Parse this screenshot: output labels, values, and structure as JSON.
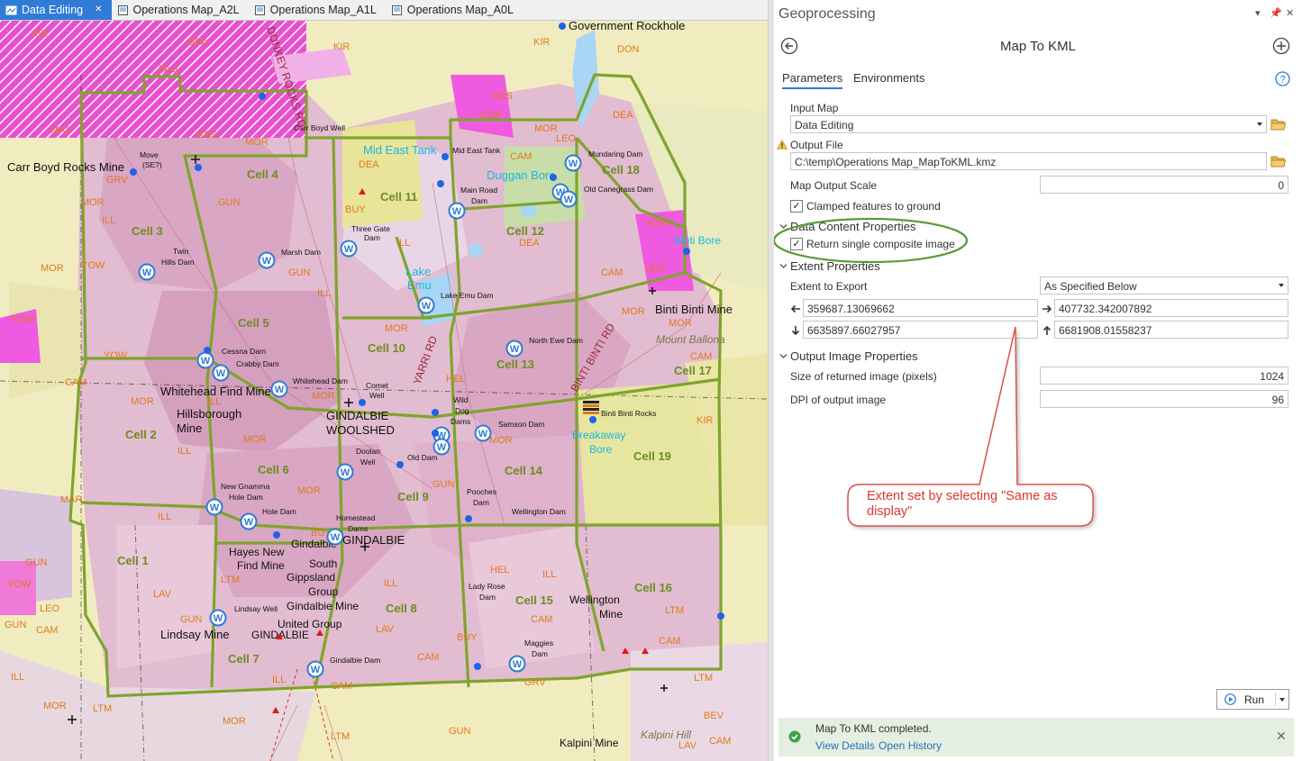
{
  "map_tabs": [
    {
      "label": "Data Editing",
      "active": true
    },
    {
      "label": "Operations Map_A2L",
      "active": false
    },
    {
      "label": "Operations Map_A1L",
      "active": false
    },
    {
      "label": "Operations Map_A0L",
      "active": false
    }
  ],
  "map": {
    "cells": [
      "Cell 1",
      "Cell 2",
      "Cell 3",
      "Cell 4",
      "Cell 5",
      "Cell 6",
      "Cell 7",
      "Cell 8",
      "Cell 9",
      "Cell 10",
      "Cell 11",
      "Cell 12",
      "Cell 13",
      "Cell 14",
      "Cell 15",
      "Cell 16",
      "Cell 17",
      "Cell 18",
      "Cell 19"
    ],
    "places": [
      "Government Rockhole",
      "Carr Boyd Rocks Mine",
      "Mid East Tank",
      "Duggan Bore",
      "Lake Emu",
      "Binti Bore",
      "Binti Binti Mine",
      "Mount Ballona",
      "Whitehead Find Mine",
      "Hillsborough Mine",
      "GINDALBIE WOOLSHED",
      "GINDALBIE",
      "Gindalbie",
      "Hayes New Find Mine",
      "South Gippsland Group",
      "Gindalbie Mine",
      "United Group",
      "Lindsay Mine",
      "Wellington Mine",
      "Kalpini Mine",
      "Kalpini Hill",
      "Breakaway Bore",
      "Binti Binti Rocks"
    ],
    "dams": [
      "Carr Boyd Well",
      "Move (SE?)",
      "Mid East Tank",
      "Main Road Dam",
      "Mundaring Dam",
      "Old Canegrass Dam",
      "Three Gate Dam",
      "Marsh Dam",
      "Twin Hills Dam",
      "Lake Emu Dam",
      "North Ewe Dam",
      "Cessna Dam",
      "Crabby Dam",
      "Whitehead Dam",
      "Comet Well",
      "Wild Dog Dams",
      "Samson Dam",
      "Doolan Well",
      "Old Dam",
      "Pooches Dam",
      "Wellington Dam",
      "New Gnamma Hole Dam",
      "Hole Dam",
      "Homestead Dams",
      "Lady Rose Dam",
      "Lindsay Well",
      "Maggies Dam",
      "Gindalbie Dam"
    ],
    "roads": [
      "DONKEY ROCKS RD",
      "YARRI RD",
      "BINTI BINTI RD"
    ],
    "geo_codes": [
      "MOR",
      "DEA",
      "KIR",
      "GRS",
      "YOW",
      "CAM",
      "LEO",
      "DON",
      "BAN",
      "GRV",
      "ILL",
      "GUN",
      "BUY",
      "HEL",
      "LTM",
      "LAV",
      "BEV",
      "MAS",
      "FAU",
      "DEA"
    ]
  },
  "gp": {
    "pane_title": "Geoprocessing",
    "tool_title": "Map To KML",
    "tabs": {
      "parameters": "Parameters",
      "environments": "Environments"
    },
    "input_map": {
      "label": "Input Map",
      "value": "Data Editing"
    },
    "output_file": {
      "label": "Output File",
      "value": "C:\\temp\\Operations Map_MapToKML.kmz"
    },
    "map_output_scale": {
      "label": "Map Output Scale",
      "value": "0"
    },
    "clamped": {
      "label": "Clamped features to ground",
      "checked": true
    },
    "data_content": {
      "title": "Data Content Properties",
      "composite_label": "Return single composite image",
      "checked": true
    },
    "extent": {
      "title": "Extent Properties",
      "export_label": "Extent to Export",
      "export_value": "As Specified Below",
      "left": "359687.13069662",
      "right": "407732.342007892",
      "bottom": "6635897.66027957",
      "top": "6681908.01558237"
    },
    "output_image": {
      "title": "Output Image Properties",
      "size_label": "Size of returned image (pixels)",
      "size_value": "1024",
      "dpi_label": "DPI of output image",
      "dpi_value": "96"
    },
    "callout": "Extent set by selecting \"Same as display\"",
    "run_label": "Run",
    "status": {
      "message": "Map To KML completed.",
      "view_details": "View Details",
      "open_history": "Open History"
    },
    "colors": {
      "accent": "#2f7bd6",
      "annotation_green": "#5a9a3c",
      "callout_red": "#e0362f",
      "success_bg": "#e4efe2"
    }
  }
}
